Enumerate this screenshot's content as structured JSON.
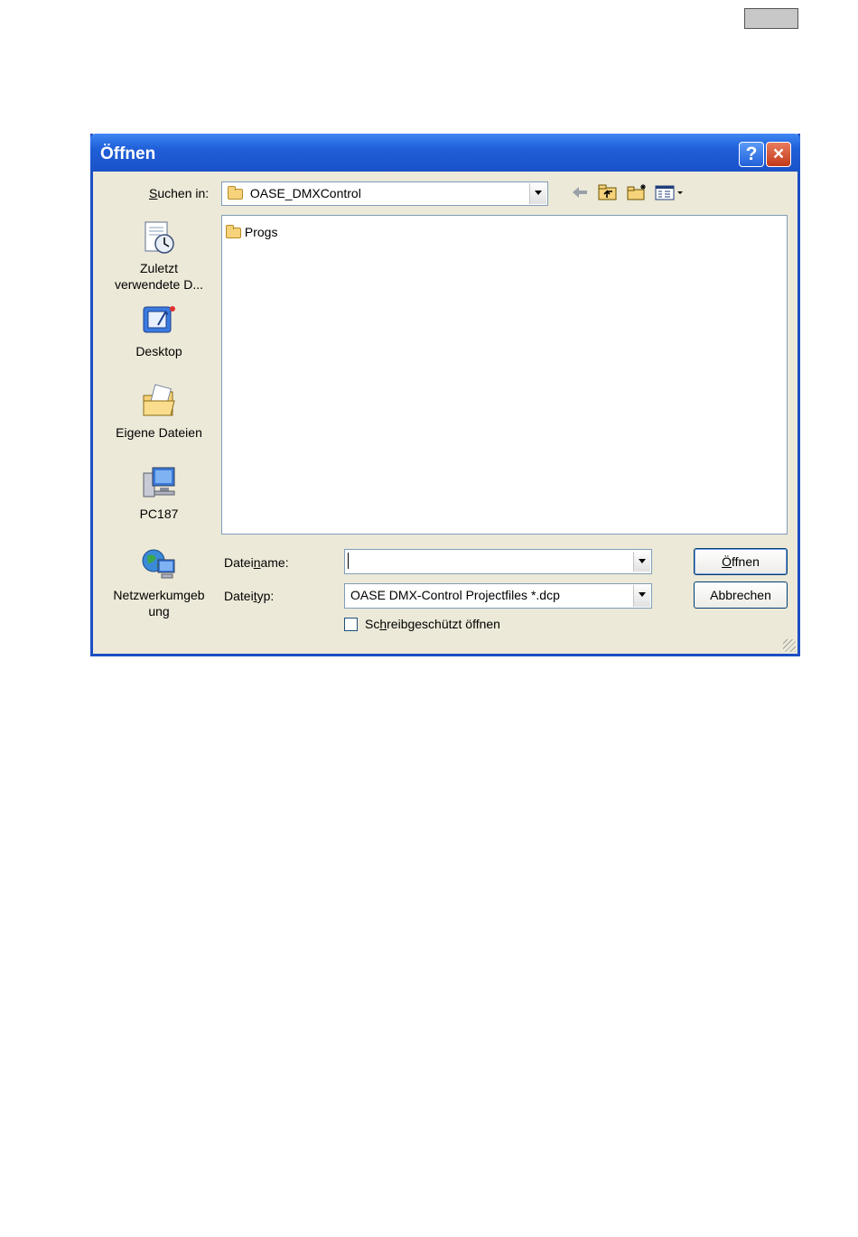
{
  "dialog": {
    "title": "Öffnen",
    "help_symbol": "?",
    "close_symbol": "×"
  },
  "lookin": {
    "label_underlined": "S",
    "label_rest": "uchen in:",
    "value": "OASE_DMXControl"
  },
  "toolbar": {
    "icons": [
      "back-arrow-icon",
      "up-folder-icon",
      "new-folder-icon",
      "view-menu-icon"
    ]
  },
  "places": [
    {
      "line1": "Zuletzt",
      "line2": "verwendete D...",
      "icon": "recent-documents-icon"
    },
    {
      "line1": "Desktop",
      "line2": "",
      "icon": "desktop-icon"
    },
    {
      "line1": "Eigene Dateien",
      "line2": "",
      "icon": "my-documents-icon"
    },
    {
      "line1": "PC187",
      "line2": "",
      "icon": "computer-icon"
    },
    {
      "line1": "Netzwerkumgeb",
      "line2": "ung",
      "icon": "network-icon"
    }
  ],
  "files": [
    {
      "name": "Progs",
      "icon": "folder-icon"
    }
  ],
  "filename": {
    "label_pre": "Datei",
    "label_underlined": "n",
    "label_post": "ame:",
    "value": ""
  },
  "filetype": {
    "label_pre": "Datei",
    "label_underlined": "t",
    "label_post": "yp:",
    "value": "OASE DMX-Control Projectfiles *.dcp"
  },
  "readonly": {
    "label_pre": "Sc",
    "label_underlined": "h",
    "label_post": "reibgeschützt öffnen",
    "checked": false
  },
  "buttons": {
    "open_underlined": "Ö",
    "open_rest": "ffnen",
    "cancel": "Abbrechen"
  },
  "colors": {
    "titlebar": "#1f5fd8",
    "dialog_bg": "#ece9d8",
    "close_button": "#c23a1a"
  }
}
